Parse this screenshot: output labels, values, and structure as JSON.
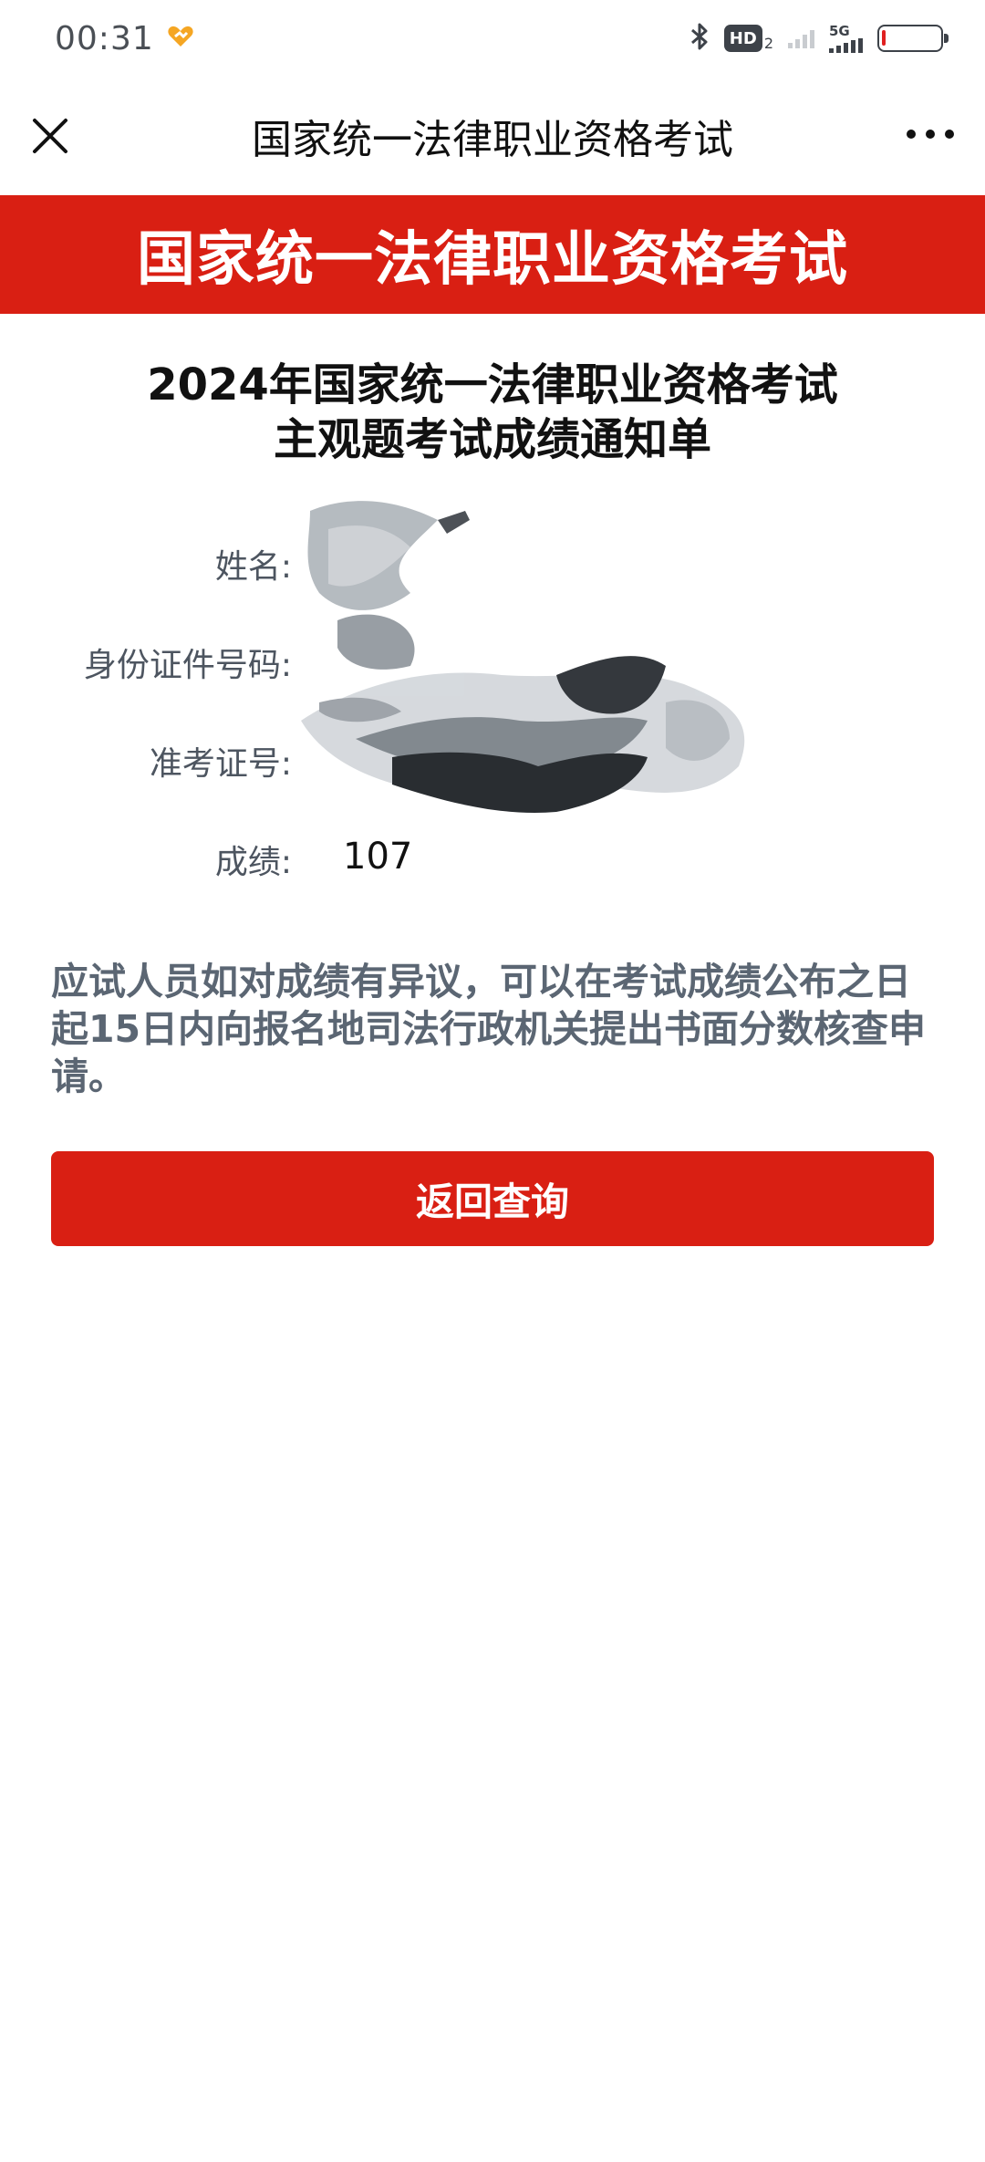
{
  "status_bar": {
    "time": "00:31",
    "hd_label": "HD",
    "hd_sub": "2",
    "network_label": "5G"
  },
  "nav": {
    "title": "国家统一法律职业资格考试"
  },
  "banner": {
    "title": "国家统一法律职业资格考试"
  },
  "notice": {
    "title_line1": "2024年国家统一法律职业资格考试",
    "title_line2": "主观题考试成绩通知单",
    "fields": [
      {
        "label": "姓名:",
        "value": ""
      },
      {
        "label": "身份证件号码:",
        "value": ""
      },
      {
        "label": "准考证号:",
        "value": ""
      },
      {
        "label": "成绩:",
        "value": "107"
      }
    ],
    "appeal_text": "应试人员如对成绩有异议，可以在考试成绩公布之日起15日内向报名地司法行政机关提出书面分数核查申请。"
  },
  "actions": {
    "back_label": "返回查询"
  },
  "colors": {
    "brand_red": "#d91f13",
    "label_gray": "#4d5560",
    "notice_gray": "#5b6673"
  },
  "icons": {
    "close": "close-icon",
    "more": "more-icon",
    "bluetooth": "bluetooth-icon",
    "battery": "battery-icon",
    "notification": "heart-notification-icon"
  }
}
